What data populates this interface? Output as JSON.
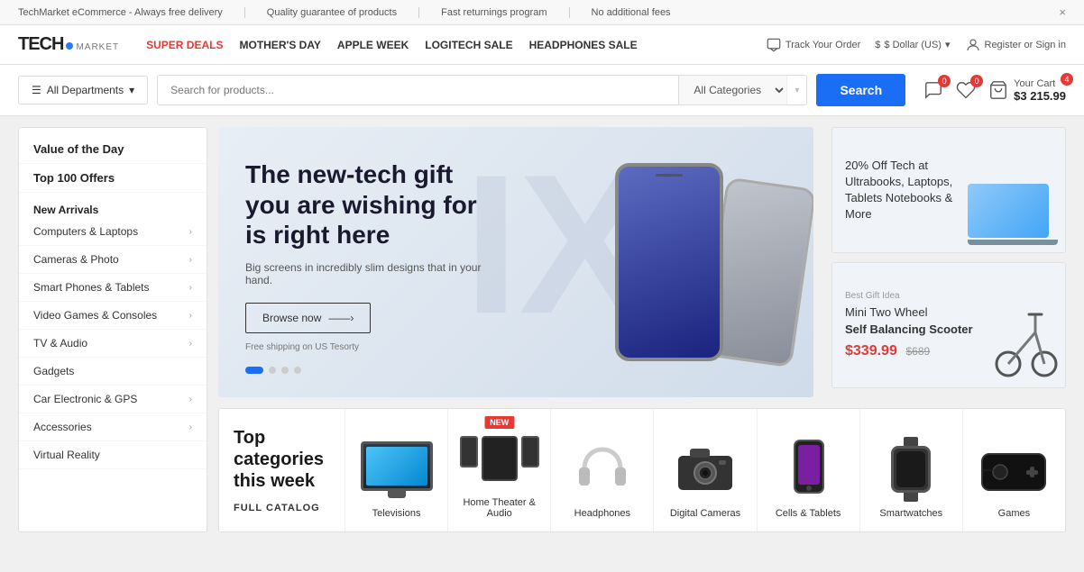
{
  "topbar": {
    "items": [
      "TechMarket eCommerce - Always free delivery",
      "Quality guarantee of products",
      "Fast returnings program",
      "No additional fees"
    ],
    "close": "×"
  },
  "header": {
    "logo_tech": "TECH",
    "logo_market": "MARKET",
    "nav": [
      {
        "label": "SUPER DEALS",
        "active": true
      },
      {
        "label": "MOTHER'S DAY",
        "active": false
      },
      {
        "label": "APPLE WEEK",
        "active": false
      },
      {
        "label": "LOGITECH SALE",
        "active": false
      },
      {
        "label": "HEADPHONES SALE",
        "active": false
      }
    ],
    "track_order": "Track Your Order",
    "currency": "$ Dollar (US)",
    "register": "Register or Sign in"
  },
  "search": {
    "placeholder": "Search for products...",
    "all_categories": "All Categories",
    "button_label": "Search",
    "all_departments": "All Departments"
  },
  "cart": {
    "comments_count": "0",
    "wishlist_count": "0",
    "cart_count": "4",
    "your_cart": "Your Cart",
    "cart_total": "$3 215.99"
  },
  "sidebar": {
    "items": [
      {
        "label": "Value of the Day",
        "has_arrow": false,
        "highlight": true
      },
      {
        "label": "Top 100 Offers",
        "has_arrow": false,
        "highlight": true
      },
      {
        "label": "New Arrivals",
        "has_arrow": false,
        "section_header": true
      },
      {
        "label": "Computers & Laptops",
        "has_arrow": true
      },
      {
        "label": "Cameras & Photo",
        "has_arrow": true
      },
      {
        "label": "Smart Phones & Tablets",
        "has_arrow": true
      },
      {
        "label": "Video Games & Consoles",
        "has_arrow": true
      },
      {
        "label": "TV & Audio",
        "has_arrow": true
      },
      {
        "label": "Gadgets",
        "has_arrow": false
      },
      {
        "label": "Car Electronic & GPS",
        "has_arrow": true
      },
      {
        "label": "Accessories",
        "has_arrow": true
      },
      {
        "label": "Virtual Reality",
        "has_arrow": false
      }
    ]
  },
  "hero": {
    "headline": "The new-tech gift you are wishing for is right here",
    "subtext": "Big screens in incredibly slim designs that in your hand.",
    "button_label": "Browse now",
    "shipping_text": "Free shipping on US Tesorty",
    "bg_letter": "IX"
  },
  "side_banners": [
    {
      "small_text": "",
      "title_normal": "20% Off Tech",
      "title_detail": "at Ultrabooks, Laptops, Tablets Notebooks & More",
      "price": "",
      "old_price": ""
    },
    {
      "small_text": "Best Gift Idea",
      "title_normal": "Mini Two Wheel",
      "title_bold": "Self Balancing Scooter",
      "price": "$339.99",
      "old_price": "$689"
    }
  ],
  "categories": {
    "heading": "Top categories this week",
    "full_catalog": "FULL CATALOG",
    "items": [
      {
        "name": "Televisions",
        "is_new": false
      },
      {
        "name": "Home Theater & Audio",
        "is_new": true
      },
      {
        "name": "Headphones",
        "is_new": false
      },
      {
        "name": "Digital Cameras",
        "is_new": false
      },
      {
        "name": "Cells & Tablets",
        "is_new": false
      },
      {
        "name": "Smartwatches",
        "is_new": false
      },
      {
        "name": "Games",
        "is_new": false
      }
    ]
  }
}
